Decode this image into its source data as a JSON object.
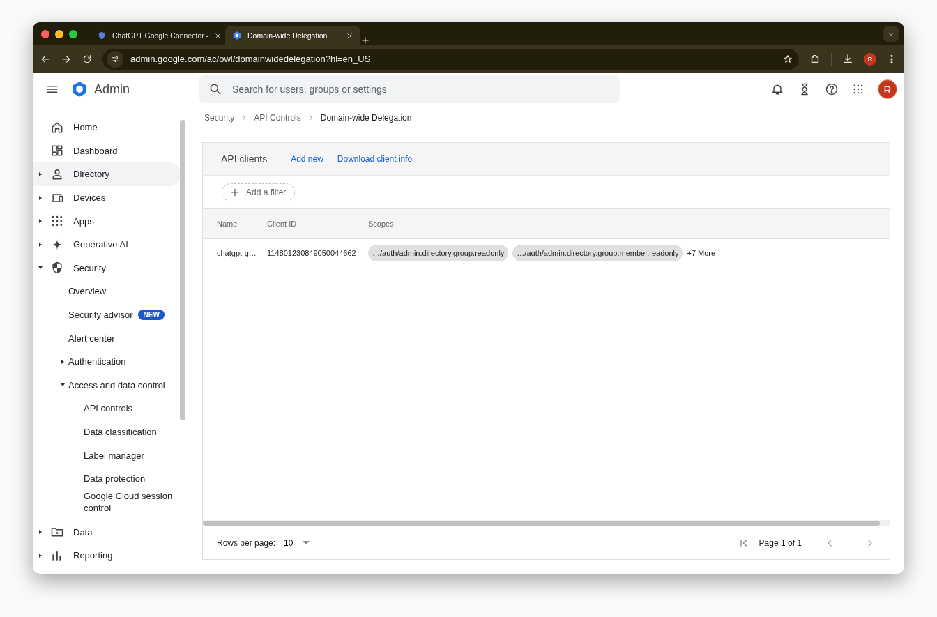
{
  "browser": {
    "tabs": [
      {
        "title": "ChatGPT Google Connector -",
        "selected": false
      },
      {
        "title": "Domain-wide Delegation",
        "selected": true
      }
    ],
    "url": "admin.google.com/ac/owl/domainwidedelegation?hl=en_US",
    "profile_initial": "R"
  },
  "app": {
    "product": "Admin",
    "search": {
      "placeholder": "Search for users, groups or settings"
    },
    "avatar_initial": "R"
  },
  "sidebar": {
    "items": [
      {
        "label": "Home",
        "selected": false
      },
      {
        "label": "Dashboard",
        "selected": false
      },
      {
        "label": "Directory",
        "selected": true,
        "expanded": false
      },
      {
        "label": "Devices",
        "selected": false,
        "expanded": false
      },
      {
        "label": "Apps",
        "selected": false,
        "expanded": false
      },
      {
        "label": "Generative AI",
        "selected": false,
        "expanded": false
      },
      {
        "label": "Security",
        "selected": false,
        "expanded": true,
        "children": [
          {
            "label": "Overview",
            "selected": false
          },
          {
            "label": "Security advisor",
            "selected": false,
            "badge": "NEW"
          },
          {
            "label": "Alert center",
            "selected": false
          },
          {
            "label": "Authentication",
            "selected": false,
            "expanded": false
          },
          {
            "label": "Access and data control",
            "selected": false,
            "expanded": true,
            "children": [
              {
                "label": "API controls",
                "selected": false
              },
              {
                "label": "Data classification",
                "selected": false
              },
              {
                "label": "Label manager",
                "selected": false
              },
              {
                "label": "Data protection",
                "selected": false
              },
              {
                "label": "Google Cloud session control",
                "selected": false
              }
            ]
          }
        ]
      },
      {
        "label": "Data",
        "selected": false,
        "expanded": false
      },
      {
        "label": "Reporting",
        "selected": false,
        "expanded": false
      }
    ]
  },
  "breadcrumb": [
    "Security",
    "API Controls",
    "Domain-wide Delegation"
  ],
  "card": {
    "title": "API clients",
    "actions": [
      "Add new",
      "Download client info"
    ],
    "filter_button": "Add a filter",
    "table": {
      "columns": [
        "Name",
        "Client ID",
        "Scopes"
      ],
      "rows": [
        {
          "name": "chatgpt-g…",
          "client_id": "114801230849050044662",
          "scopes": [
            "…/auth/admin.directory.group.readonly",
            "…/auth/admin.directory.group.member.readonly"
          ],
          "more": "+7 More"
        }
      ]
    },
    "pagination": {
      "rows_per_page_label": "Rows per page:",
      "rows_per_page": "10",
      "page_label": "Page 1 of 1"
    }
  }
}
